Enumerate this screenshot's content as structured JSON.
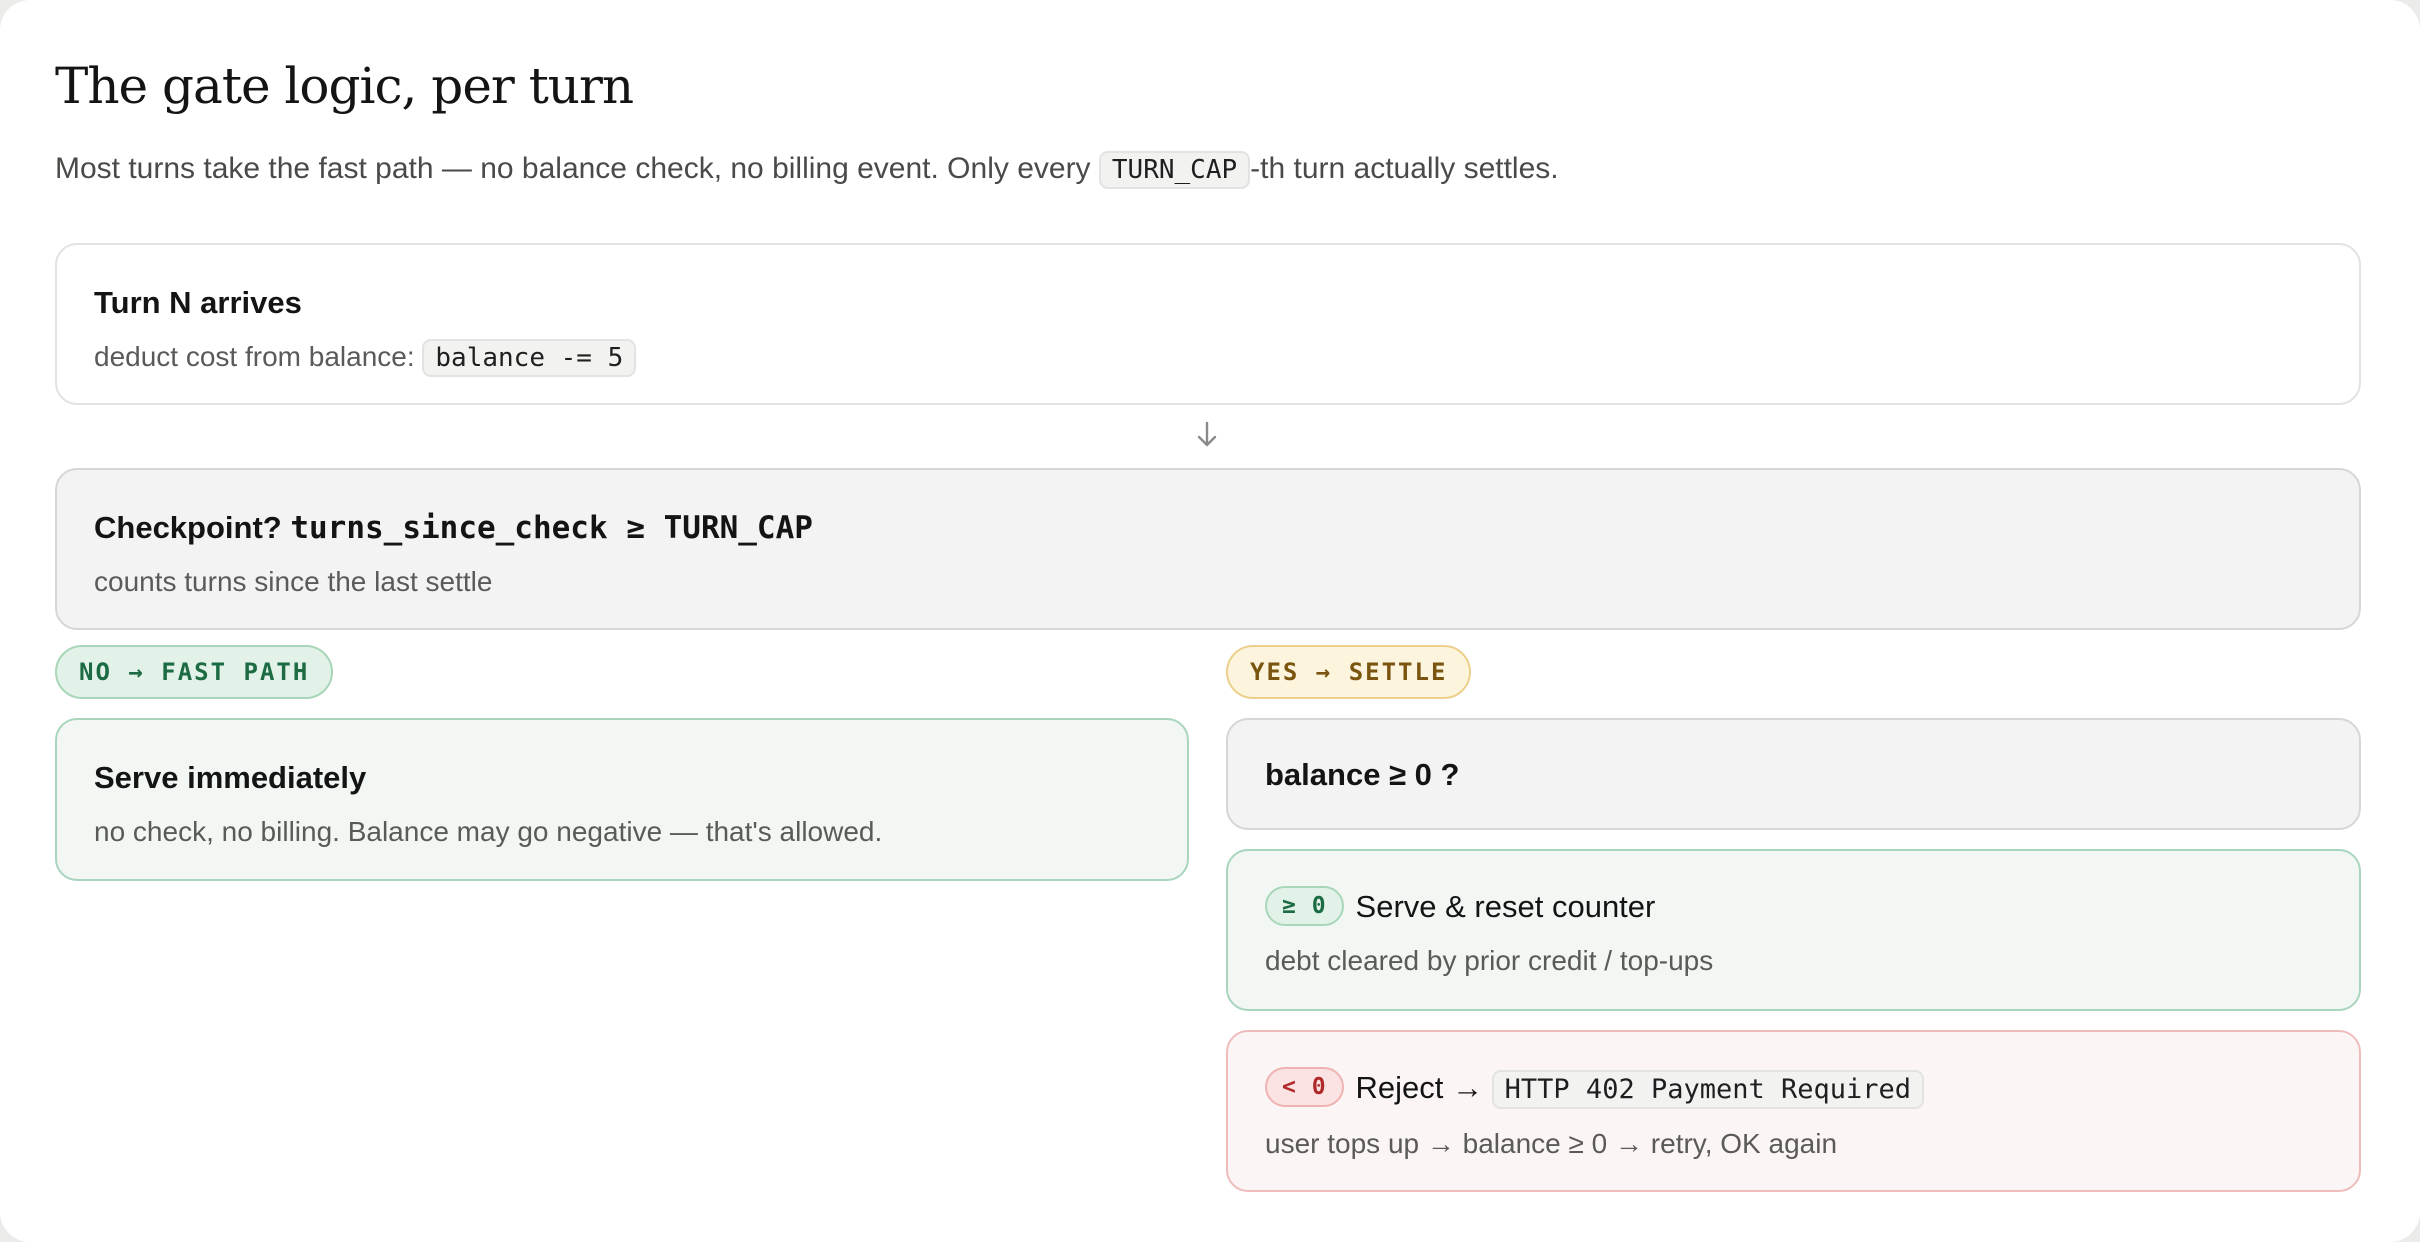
{
  "title": "The gate logic, per turn",
  "subtitle": {
    "before": "Most turns take the fast path — no balance check, no billing event. Only every ",
    "code": "TURN_CAP",
    "after": "-th turn actually settles."
  },
  "step1": {
    "title": "Turn N arrives",
    "desc_prefix": "deduct cost from balance: ",
    "desc_code": "balance -= 5"
  },
  "arrow_icon": "arrow-down-icon",
  "checkpoint": {
    "title_prefix": "Checkpoint? ",
    "title_code": "turns_since_check ≥ TURN_CAP",
    "desc": "counts turns since the last settle"
  },
  "no_branch": {
    "pill": "NO → FAST PATH",
    "title": "Serve immediately",
    "desc": "no check, no billing. Balance may go negative — that's allowed."
  },
  "yes_branch": {
    "pill": "YES → SETTLE",
    "question": "balance ≥ 0 ?",
    "ok": {
      "badge": "≥ 0",
      "title": "Serve & reset counter",
      "desc": "debt cleared by prior credit / top-ups"
    },
    "reject": {
      "badge": "< 0",
      "title_prefix": "Reject → ",
      "title_code": "HTTP 402 Payment Required",
      "desc": "user tops up → balance ≥ 0 → retry, OK again"
    }
  },
  "colors": {
    "green_accent": "#1c6b43",
    "amber_accent": "#7a5510",
    "red_accent": "#b02a2a"
  }
}
